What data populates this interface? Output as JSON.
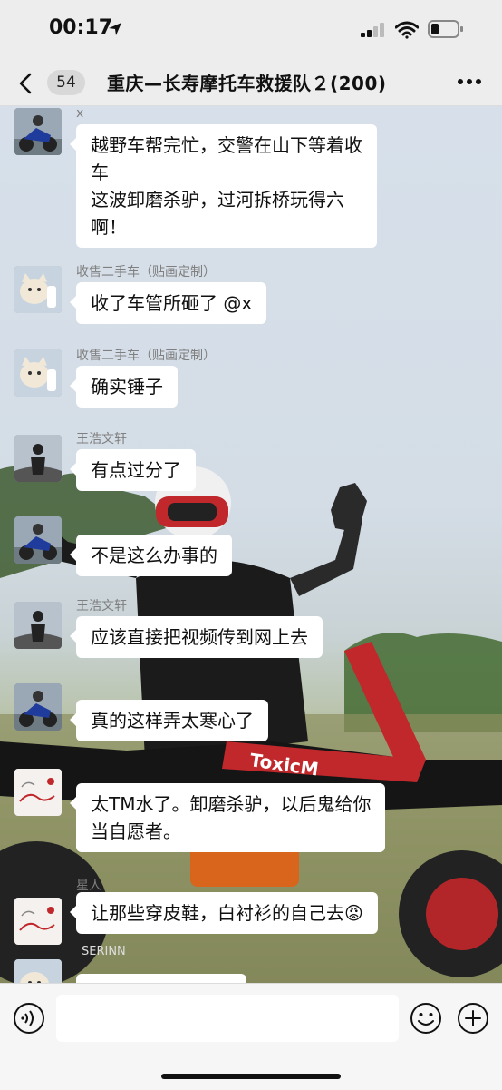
{
  "status_bar": {
    "time": "00:17",
    "icons": [
      "location-arrow-icon",
      "signal-icon",
      "wifi-icon",
      "battery-icon"
    ]
  },
  "header": {
    "unread_count": "54",
    "title": "重庆—长寿摩托车救援队２(200)",
    "back_icon": "chevron-left-icon",
    "more_icon": "more-dots-icon"
  },
  "messages": [
    {
      "sender": "x",
      "avatar": "motorbike-avatar",
      "lines": [
        "越野车帮完忙，交警在山下等着收",
        "车",
        "这波卸磨杀驴，过河拆桥玩得六",
        "啊！"
      ]
    },
    {
      "sender": "收售二手车（贴画定制）",
      "avatar": "cat-avatar",
      "lines": [
        "收了车管所砸了 @x"
      ]
    },
    {
      "sender": "收售二手车（贴画定制）",
      "avatar": "cat-avatar",
      "lines": [
        "确实锤子"
      ]
    },
    {
      "sender": "王浩文轩",
      "avatar": "figure-avatar",
      "lines": [
        "有点过分了"
      ]
    },
    {
      "sender": "",
      "avatar": "motorbike-avatar",
      "lines": [
        "不是这么办事的"
      ]
    },
    {
      "sender": "王浩文轩",
      "avatar": "figure-avatar",
      "lines": [
        "应该直接把视频传到网上去"
      ]
    },
    {
      "sender": "",
      "avatar": "motorbike-avatar",
      "lines": [
        "真的这样弄太寒心了"
      ]
    },
    {
      "sender": "",
      "avatar": "sketch-avatar",
      "lines": [
        "太TM水了。卸磨杀驴，以后鬼给你",
        "当自愿者。"
      ]
    },
    {
      "sender": "星人",
      "avatar": "sketch-avatar",
      "lines": [
        "让那些穿皮鞋，白衬衫的自己去😡"
      ]
    },
    {
      "sender": "",
      "avatar": "cat-avatar",
      "lines": [
        ""
      ]
    }
  ],
  "background": {
    "text": [
      "ToxicM",
      "SERINN"
    ],
    "colors": {
      "sky": "#d7e0ea",
      "grass": "#7a8656",
      "jersey": "#1b1b1b",
      "bike_red": "#c0282b"
    }
  },
  "input_bar": {
    "value": "",
    "placeholder": "",
    "icons": [
      "voice-icon",
      "emoji-icon",
      "plus-icon"
    ]
  },
  "colors": {
    "bubble": "#ffffff",
    "header": "#ededed",
    "sender": "#7f7f7f"
  }
}
